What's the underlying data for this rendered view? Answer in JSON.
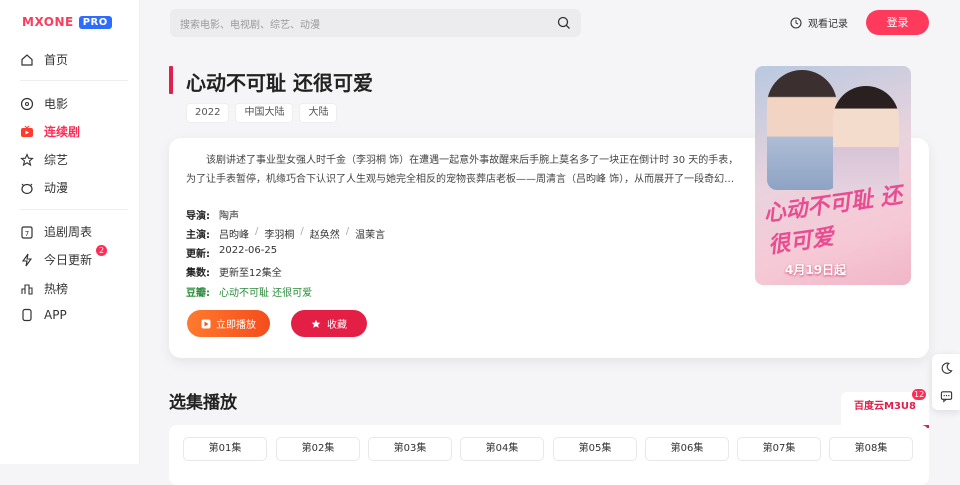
{
  "logo": {
    "brand": "MXONE",
    "badge": "PRO"
  },
  "sidebar": {
    "items": [
      {
        "label": "首页",
        "icon": "home-icon"
      },
      {
        "label": "电影",
        "icon": "film-icon"
      },
      {
        "label": "连续剧",
        "icon": "tv-icon",
        "active": true
      },
      {
        "label": "综艺",
        "icon": "star-icon"
      },
      {
        "label": "动漫",
        "icon": "anime-icon"
      },
      {
        "label": "追剧周表",
        "icon": "calendar-icon"
      },
      {
        "label": "今日更新",
        "icon": "lightning-icon",
        "badge": "2"
      },
      {
        "label": "热榜",
        "icon": "chart-icon"
      },
      {
        "label": "APP",
        "icon": "phone-icon"
      }
    ]
  },
  "search": {
    "placeholder": "搜索电影、电视剧、综艺、动漫"
  },
  "header": {
    "history": "观看记录",
    "login": "登录"
  },
  "detail": {
    "title": "心动不可耻 还很可爱",
    "tags": [
      "2022",
      "中国大陆",
      "大陆"
    ],
    "description": "该剧讲述了事业型女强人时千金（李羽桐 饰）在遭遇一起意外事故醒来后手腕上莫名多了一块正在倒计时 30 天的手表，为了让手表暂停，机缘巧合下认识了人生观与她完全相反的宠物丧葬店老板——周清言（吕昀峰 饰），从而展开了一段奇幻…",
    "director_label": "导演:",
    "director": "陶声",
    "cast_label": "主演:",
    "cast": [
      "吕昀峰",
      "李羽桐",
      "赵奂然",
      "温茉言"
    ],
    "update_label": "更新:",
    "update": "2022-06-25",
    "episodes_label": "集数:",
    "episodes": "更新至12集全",
    "douban_label": "豆瓣:",
    "douban": "心动不可耻 还很可爱",
    "play_button": "立即播放",
    "fav_button": "收藏"
  },
  "poster": {
    "title_art": "心动不可耻 还很可爱",
    "date_text": "4月19日起"
  },
  "episodes_section": {
    "title": "选集播放",
    "source_tab": "百度云M3U8",
    "source_count": "12",
    "list": [
      "第01集",
      "第02集",
      "第03集",
      "第04集",
      "第05集",
      "第06集",
      "第07集",
      "第08集"
    ]
  },
  "colors": {
    "accent": "#ff2d55",
    "play": "#f4571f",
    "fav": "#e41f45",
    "douban": "#2c8c3c"
  }
}
